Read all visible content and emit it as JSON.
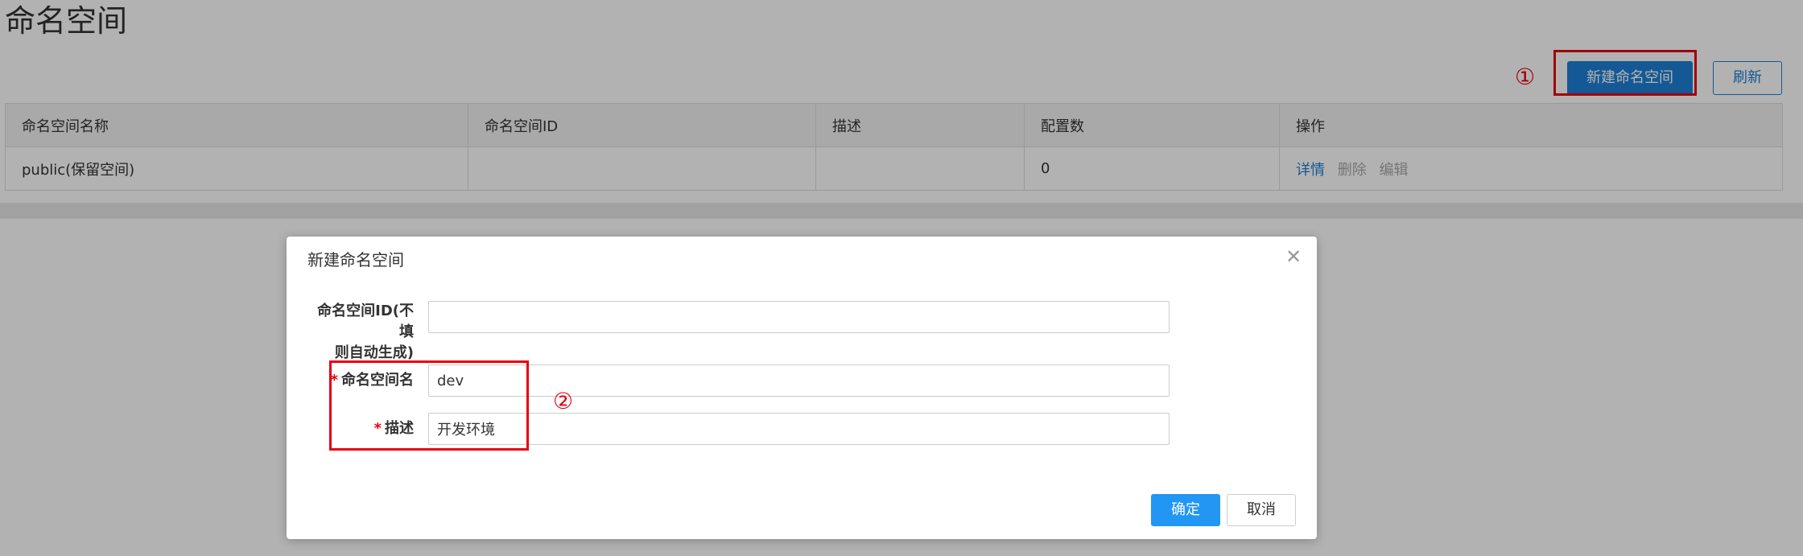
{
  "page": {
    "title": "命名空间",
    "new_button": "新建命名空间",
    "refresh_button": "刷新",
    "annotation_1": "①",
    "annotation_2": "②"
  },
  "table": {
    "columns": [
      "命名空间名称",
      "命名空间ID",
      "描述",
      "配置数",
      "操作"
    ],
    "rows": [
      {
        "name": "public(保留空间)",
        "id": "",
        "description": "",
        "config_count": "0",
        "actions": [
          "详情",
          "删除",
          "编辑"
        ]
      }
    ]
  },
  "dialog": {
    "title": "新建命名空间",
    "close_icon": "close-icon",
    "fields": [
      {
        "label_line1": "命名空间ID(不填",
        "label_line2": "则自动生成)",
        "required": false,
        "value": ""
      },
      {
        "label": "命名空间名",
        "required": true,
        "required_mark": "*",
        "value": "dev"
      },
      {
        "label": "描述",
        "required": true,
        "required_mark": "*",
        "value": "开发环境"
      }
    ],
    "ok_button": "确定",
    "cancel_button": "取消"
  },
  "colors": {
    "primary": "#1e80d6",
    "annotation_red": "#e60012",
    "overlay": "rgba(0,0,0,0.3)"
  }
}
